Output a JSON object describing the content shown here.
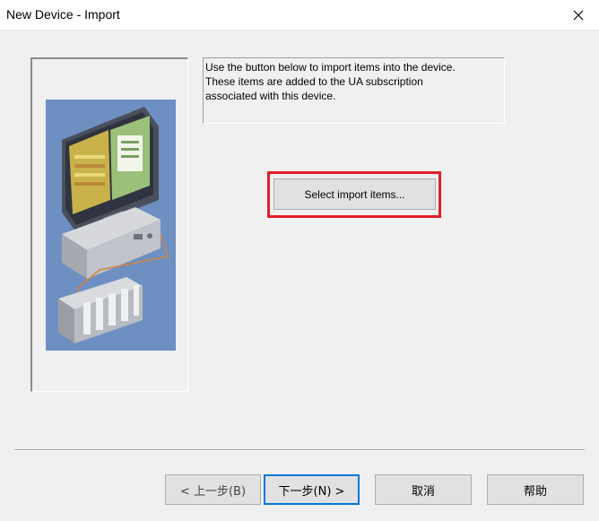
{
  "window": {
    "title": "New Device - Import",
    "close_icon": "close-icon"
  },
  "description": "Use the button below to import items into the device.\nThese items are added to the UA subscription\nassociated with this device.",
  "select_button": {
    "label": "Select import items..."
  },
  "buttons": {
    "back": "< 上一步(B)",
    "next": "下一步(N) >",
    "cancel": "取消",
    "help": "帮助"
  },
  "colors": {
    "highlight": "#e21f26",
    "accent": "#0078d7",
    "art_background": "#6e8fc2"
  }
}
